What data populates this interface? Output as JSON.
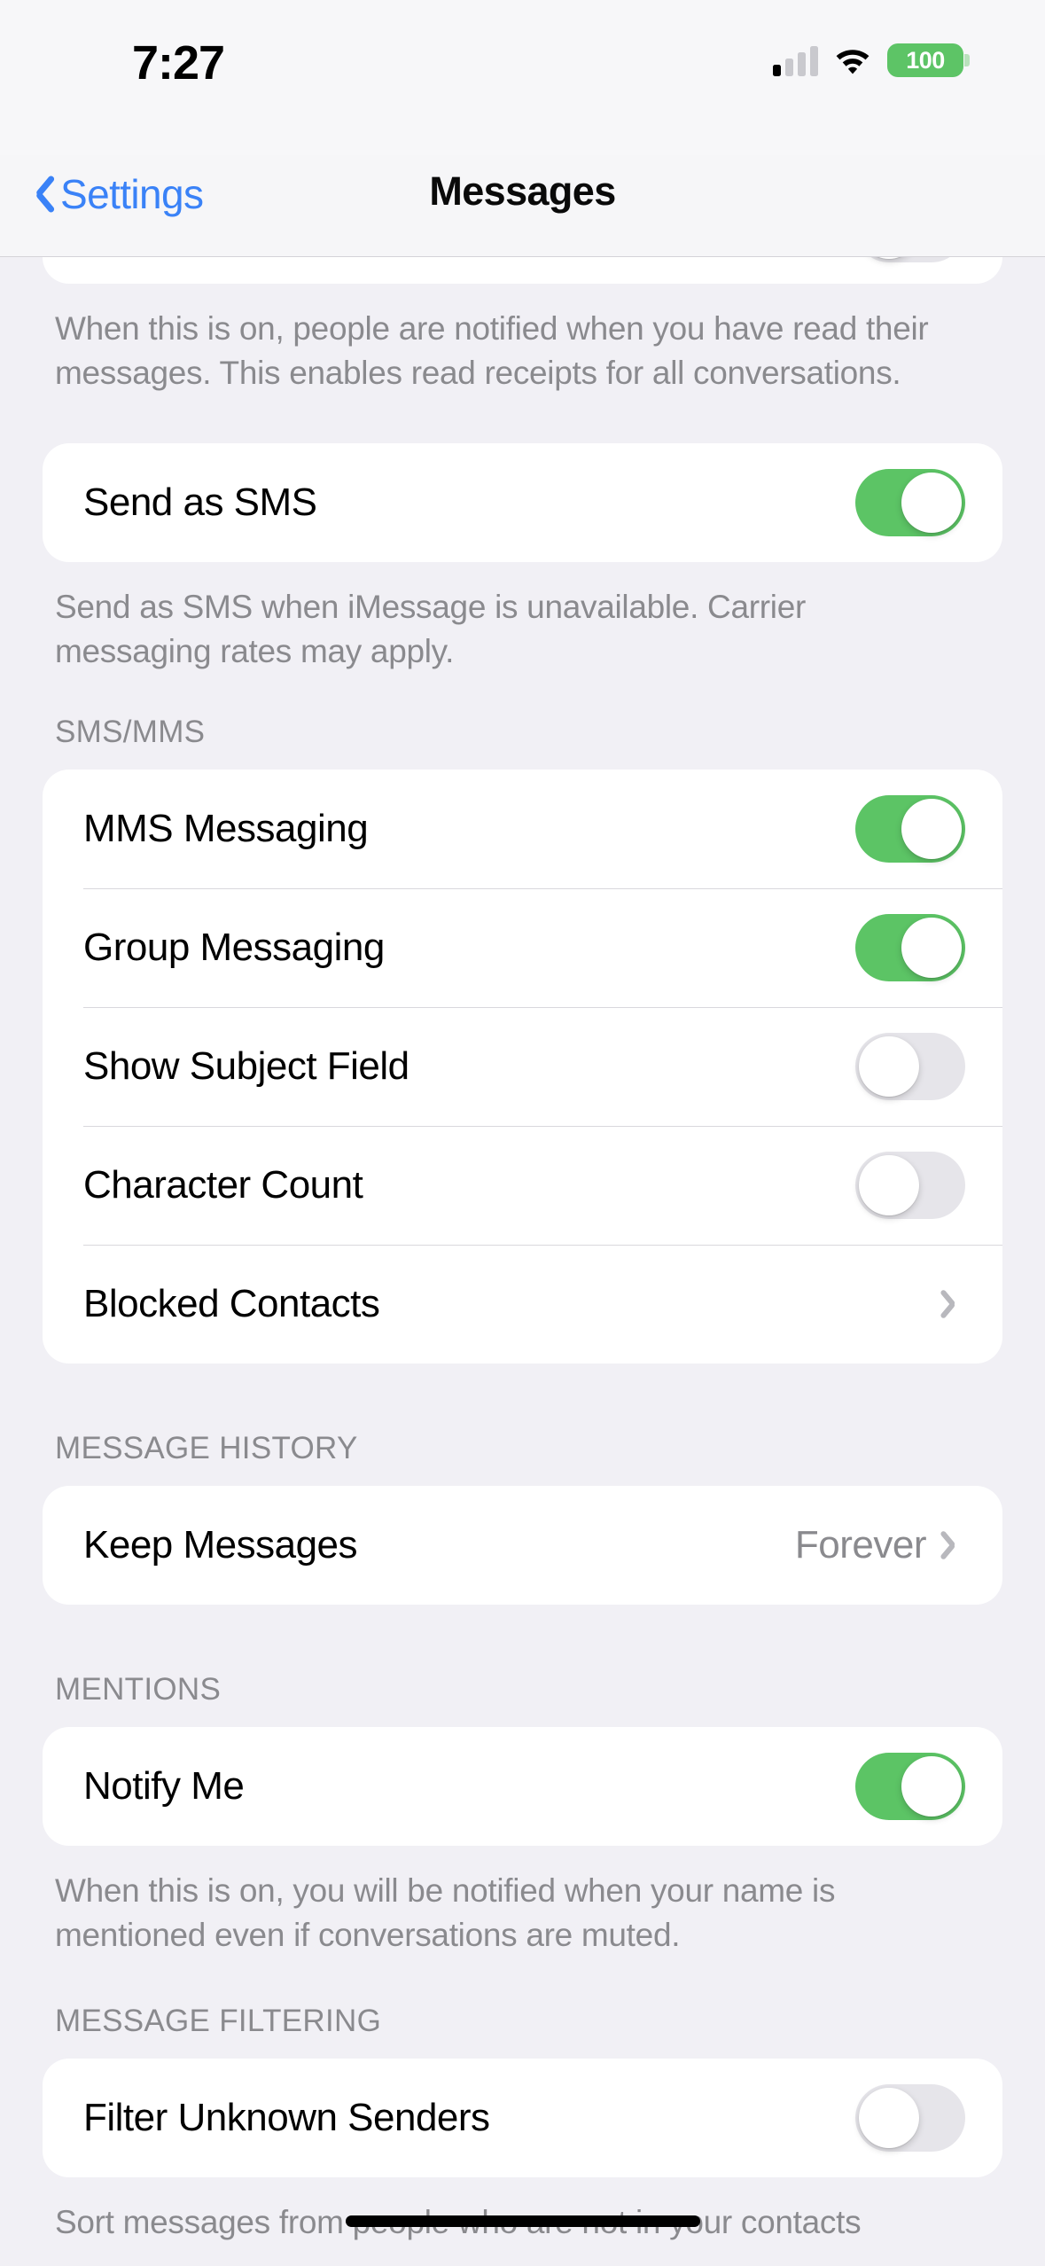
{
  "status_bar": {
    "time": "7:27",
    "battery_percent": "100",
    "cellular_icon": "cellular-bars-icon",
    "wifi_icon": "wifi-icon",
    "battery_icon": "battery-icon",
    "battery_color": "#5DC466",
    "signal_bars_filled": 1,
    "signal_bars_total": 4
  },
  "nav": {
    "back_label": "Settings",
    "back_icon": "chevron-left-icon",
    "title": "Messages",
    "accent_color": "#3A82F7"
  },
  "theme": {
    "background": "#F1F0F5",
    "card": "#FFFFFF",
    "toggle_on": "#5CC465",
    "toggle_off": "#E6E5EA",
    "secondary_text": "#8A8A8E",
    "separator": "#D9D8DD"
  },
  "sections": [
    {
      "id": "read-receipts",
      "header": "",
      "clipped_top": true,
      "rows": [
        {
          "label": "",
          "control": "toggle",
          "value": "off",
          "name": "send-read-receipts-row"
        }
      ],
      "footer": "When this is on, people are notified when you have read their messages. This enables read receipts for all conversations."
    },
    {
      "id": "send-as-sms",
      "header": "",
      "rows": [
        {
          "label": "Send as SMS",
          "control": "toggle",
          "value": "on",
          "name": "send-as-sms-row"
        }
      ],
      "footer": "Send as SMS when iMessage is unavailable. Carrier messaging rates may apply."
    },
    {
      "id": "sms-mms",
      "header": "SMS/MMS",
      "rows": [
        {
          "label": "MMS Messaging",
          "control": "toggle",
          "value": "on",
          "name": "mms-messaging-row"
        },
        {
          "label": "Group Messaging",
          "control": "toggle",
          "value": "on",
          "name": "group-messaging-row"
        },
        {
          "label": "Show Subject Field",
          "control": "toggle",
          "value": "off",
          "name": "show-subject-field-row"
        },
        {
          "label": "Character Count",
          "control": "toggle",
          "value": "off",
          "name": "character-count-row"
        },
        {
          "label": "Blocked Contacts",
          "control": "disclosure",
          "value": "",
          "name": "blocked-contacts-row"
        }
      ],
      "footer": ""
    },
    {
      "id": "message-history",
      "header": "MESSAGE HISTORY",
      "rows": [
        {
          "label": "Keep Messages",
          "control": "disclosure",
          "value": "Forever",
          "name": "keep-messages-row"
        }
      ],
      "footer": ""
    },
    {
      "id": "mentions",
      "header": "MENTIONS",
      "rows": [
        {
          "label": "Notify Me",
          "control": "toggle",
          "value": "on",
          "name": "notify-me-row"
        }
      ],
      "footer": "When this is on, you will be notified when your name is mentioned even if conversations are muted."
    },
    {
      "id": "message-filtering",
      "header": "MESSAGE FILTERING",
      "rows": [
        {
          "label": "Filter Unknown Senders",
          "control": "toggle",
          "value": "off",
          "name": "filter-unknown-senders-row"
        }
      ],
      "footer": "Sort messages from people who are not in your contacts"
    }
  ]
}
